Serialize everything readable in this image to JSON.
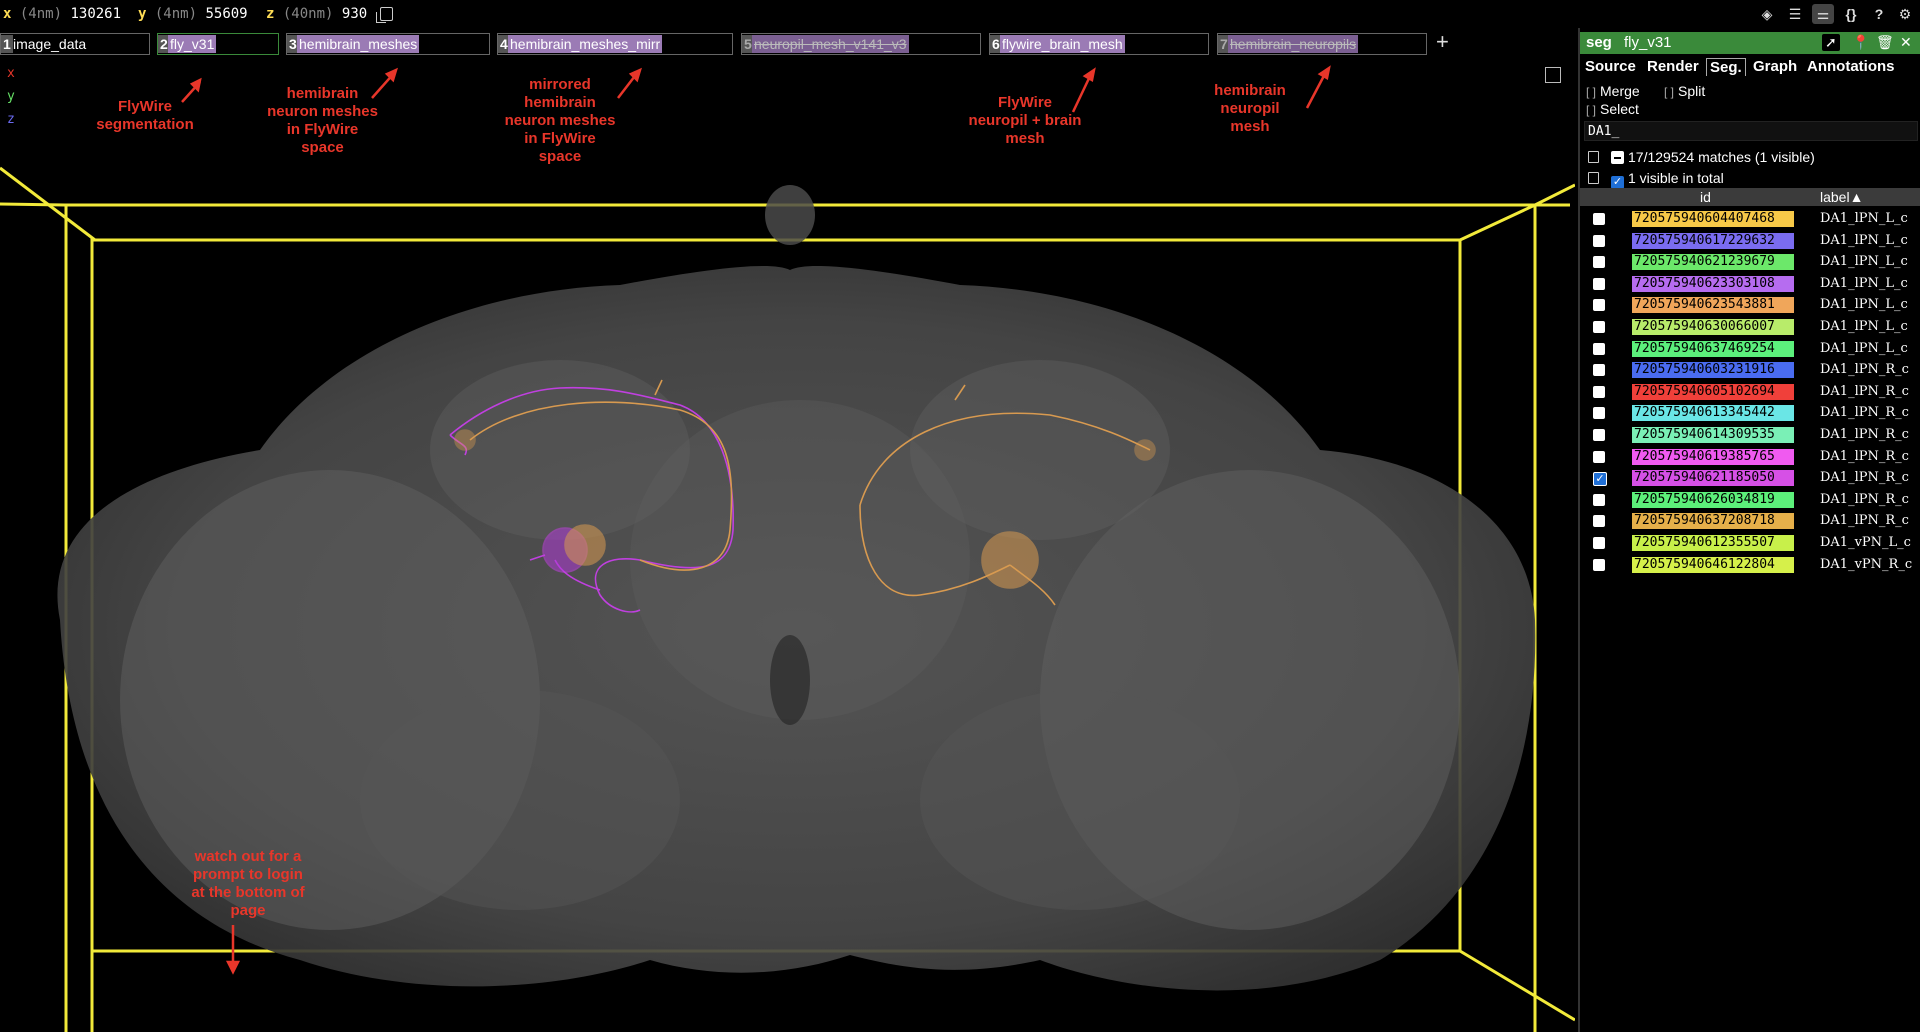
{
  "coords": {
    "x": {
      "label": "x",
      "unit": "(4nm)",
      "value": "130261",
      "color": "#ffdd55"
    },
    "y": {
      "label": "y",
      "unit": "(4nm)",
      "value": "55609",
      "color": "#ffdd55"
    },
    "z": {
      "label": "z",
      "unit": "(40nm)",
      "value": "930",
      "color": "#ffdd55"
    }
  },
  "top_icons": [
    "layers-icon",
    "list-icon",
    "sliders-icon",
    "json-icon",
    "help-icon",
    "settings-icon"
  ],
  "top_icon_glyphs": {
    "layers": "◈",
    "list": "☰",
    "sliders": "⚌",
    "json": "{}",
    "help": "?",
    "settings": "⚙"
  },
  "layers": [
    {
      "num": "1",
      "name": "image_data",
      "bg": "#000000",
      "numbg": "#555555",
      "disabled": false
    },
    {
      "num": "2",
      "name": "fly_v31",
      "bg": "#000000",
      "numbg": "#3a8a3a",
      "disabled": false
    },
    {
      "num": "3",
      "name": "hemibrain_meshes",
      "bg": "#000000",
      "numbg": "#9b7bb5",
      "disabled": false
    },
    {
      "num": "4",
      "name": "hemibrain_meshes_mirr",
      "bg": "#000000",
      "numbg": "#9b7bb5",
      "disabled": false
    },
    {
      "num": "5",
      "name": "neuropil_mesh_v141_v3",
      "bg": "#000000",
      "numbg": "#9b7bb5",
      "disabled": true
    },
    {
      "num": "6",
      "name": "flywire_brain_mesh",
      "bg": "#000000",
      "numbg": "#9b7bb5",
      "disabled": false
    },
    {
      "num": "7",
      "name": "hemibrain_neuropils",
      "bg": "#000000",
      "numbg": "#9b7bb5",
      "disabled": true
    }
  ],
  "add_layer_label": "+",
  "axes": {
    "x": "x",
    "y": "y",
    "z": "z"
  },
  "annotations": {
    "a1": [
      "FlyWire",
      "segmentation"
    ],
    "a2": [
      "hemibrain",
      "neuron meshes",
      "in FlyWire",
      "space"
    ],
    "a3": [
      "mirrored",
      "hemibrain",
      "neuron meshes",
      "in FlyWire",
      "space"
    ],
    "a4": [
      "FlyWire",
      "neuropil + brain",
      "mesh"
    ],
    "a5": [
      "hemibrain",
      "neuropil",
      "mesh"
    ],
    "a6": [
      "watch out for a",
      "prompt to login",
      "at the bottom of",
      "page"
    ]
  },
  "panel": {
    "type": "seg",
    "name": "fly_v31",
    "tabs": [
      "Source",
      "Render",
      "Seg.",
      "Graph",
      "Annotations"
    ],
    "active_tab": "Seg.",
    "merge": "Merge",
    "split": "Split",
    "select": "Select",
    "query": "DA1_",
    "matches": "17/129524 matches (1 visible)",
    "visible_total": "1 visible in total",
    "col_id": "id",
    "col_label": "label▲",
    "rows": [
      {
        "id": "720575940604407468",
        "label": "DA1_lPN_L_c",
        "color": "#f7c948",
        "checked": false
      },
      {
        "id": "720575940617229632",
        "label": "DA1_lPN_L_c",
        "color": "#7a6cf0",
        "checked": false
      },
      {
        "id": "720575940621239679",
        "label": "DA1_lPN_L_c",
        "color": "#6ce86a",
        "checked": false
      },
      {
        "id": "720575940623303108",
        "label": "DA1_lPN_L_c",
        "color": "#b66cf0",
        "checked": false
      },
      {
        "id": "720575940623543881",
        "label": "DA1_lPN_L_c",
        "color": "#f0a65a",
        "checked": false
      },
      {
        "id": "720575940630066007",
        "label": "DA1_lPN_L_c",
        "color": "#b8ec6a",
        "checked": false
      },
      {
        "id": "720575940637469254",
        "label": "DA1_lPN_L_c",
        "color": "#5cf07c",
        "checked": false
      },
      {
        "id": "720575940603231916",
        "label": "DA1_lPN_R_c",
        "color": "#4a6cf0",
        "checked": false
      },
      {
        "id": "720575940605102694",
        "label": "DA1_lPN_R_c",
        "color": "#f0403a",
        "checked": false
      },
      {
        "id": "720575940613345442",
        "label": "DA1_lPN_R_c",
        "color": "#6ae6e6",
        "checked": false
      },
      {
        "id": "720575940614309535",
        "label": "DA1_lPN_R_c",
        "color": "#7af0b6",
        "checked": false
      },
      {
        "id": "720575940619385765",
        "label": "DA1_lPN_R_c",
        "color": "#f05af0",
        "checked": false
      },
      {
        "id": "720575940621185050",
        "label": "DA1_lPN_R_c",
        "color": "#d650e6",
        "checked": true
      },
      {
        "id": "720575940626034819",
        "label": "DA1_lPN_R_c",
        "color": "#5cf07a",
        "checked": false
      },
      {
        "id": "720575940637208718",
        "label": "DA1_lPN_R_c",
        "color": "#e6b04a",
        "checked": false
      },
      {
        "id": "720575940612355507",
        "label": "DA1_vPN_L_c",
        "color": "#c8f04a",
        "checked": false
      },
      {
        "id": "720575940646122804",
        "label": "DA1_vPN_R_c",
        "color": "#d6f04a",
        "checked": false
      }
    ]
  },
  "colors": {
    "bbox": "#f2ea3a",
    "annotation": "#e8362a",
    "neuron_magenta": "#c040e0",
    "neuron_orange": "#d89a50",
    "brain": "#6a6a6a"
  }
}
